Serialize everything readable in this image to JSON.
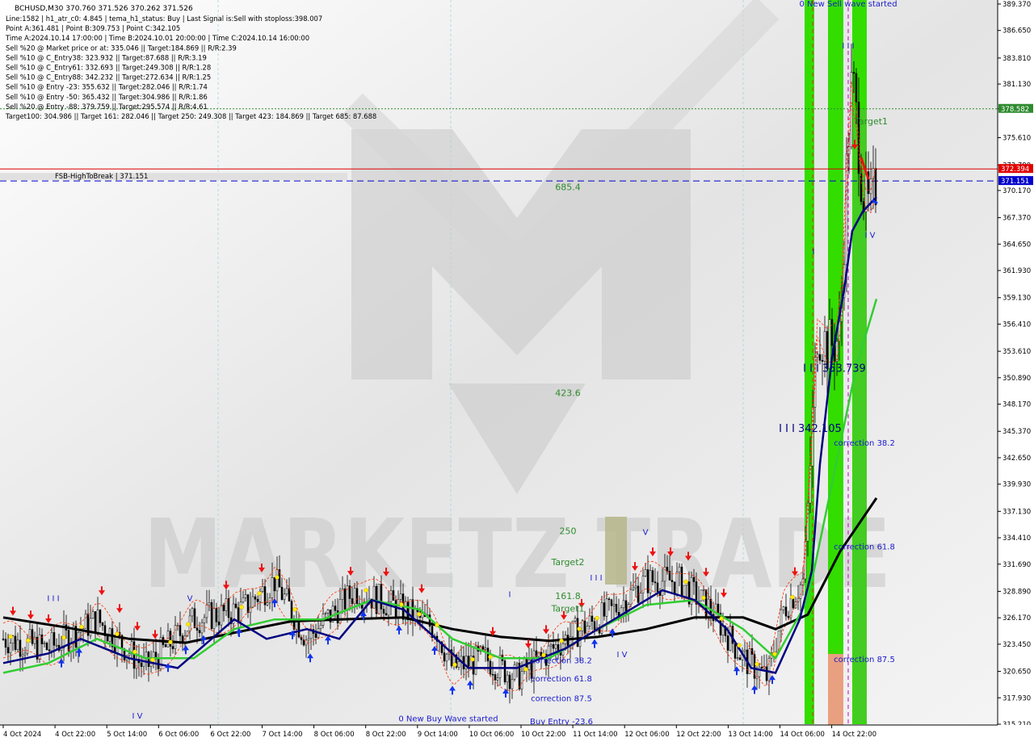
{
  "header": {
    "symbol_line": "BCHUSD,M30  370.760 371.526 370.262 371.526",
    "info_lines": [
      "Line:1582 | h1_atr_c0: 4.845 | tema_h1_status: Buy | Last Signal is:Sell with stoploss:398.007",
      "Point A:361.481 | Point B:309.753 | Point C:342.105",
      "Time A:2024.10.14 17:00:00 | Time B:2024.10.01 20:00:00 | Time C:2024.10.14 16:00:00",
      "Sell %20 @ Market price or at: 335.046 || Target:184.869 || R/R:2.39",
      "Sell %10 @ C_Entry38: 323.932 || Target:87.688 || R/R:3.19",
      "Sell %10 @ C_Entry61: 332.693 || Target:249.308 || R/R:1.28",
      "Sell %10 @ C_Entry88: 342.232 || Target:272.634 || R/R:1.25",
      "Sell %10 @ Entry -23: 355.632 || Target:282.046 || R/R:1.74",
      "Sell %10 @ Entry -50: 365.432 || Target:304.986 || R/R:1.86",
      "Sell %20 @ Entry -88: 379.759 || Target:295.574 || R/R:4.61",
      "Target100: 304.986 || Target 161: 282.046 || Target 250: 249.308 || Target 423: 184.869 || Target 685: 87.688"
    ]
  },
  "watermark": "MARKETZ TRADE",
  "colors": {
    "bull_candle": "#000000",
    "ema_black": "#000000",
    "ema_blue": "#000080",
    "ema_green": "#32cd32",
    "red_line": "#e00000",
    "blue_line": "#0000cc",
    "green_bar": "#33dd00",
    "salmon_bar": "#e8a080",
    "target_green": "#2e8b2e",
    "label_blue": "#1a1acc"
  },
  "chart_data": {
    "type": "candlestick",
    "symbol": "BCHUSD",
    "timeframe": "M30",
    "ylim": [
      315.21,
      389.37
    ],
    "y_ticks": [
      "389.370",
      "386.650",
      "383.810",
      "381.130",
      "378.582",
      "375.610",
      "372.790",
      "370.170",
      "367.370",
      "364.650",
      "361.930",
      "359.130",
      "356.410",
      "353.610",
      "350.890",
      "348.170",
      "345.370",
      "342.650",
      "339.930",
      "337.130",
      "334.410",
      "331.690",
      "328.890",
      "326.170",
      "323.450",
      "320.650",
      "317.930",
      "315.210"
    ],
    "x_labels": [
      "4 Oct 2024",
      "4 Oct 22:00",
      "5 Oct 14:00",
      "6 Oct 06:00",
      "6 Oct 22:00",
      "7 Oct 14:00",
      "8 Oct 06:00",
      "8 Oct 22:00",
      "9 Oct 14:00",
      "10 Oct 06:00",
      "10 Oct 22:00",
      "11 Oct 14:00",
      "12 Oct 06:00",
      "12 Oct 22:00",
      "13 Oct 14:00",
      "14 Oct 06:00",
      "14 Oct 22:00"
    ],
    "price_tags": [
      {
        "value": 378.582,
        "label": "378.582",
        "color": "#2e8b2e"
      },
      {
        "value": 372.394,
        "label": "372.394",
        "color": "#e00000"
      },
      {
        "value": 371.151,
        "label": "371.151",
        "color": "#0000cc"
      }
    ],
    "fsb_label": "FSB-HighToBreak | 371.151",
    "levels": [
      {
        "name": "685.4",
        "y": 370.2
      },
      {
        "name": "423.6",
        "y": 349.0
      },
      {
        "name": "250",
        "y": 334.8
      },
      {
        "name": "Target2",
        "y": 331.6
      },
      {
        "name": "161.8",
        "y": 328.1
      },
      {
        "name": "Target1",
        "y": 326.8
      },
      {
        "name": "Target1",
        "y": 377.0
      }
    ],
    "wave_labels": [
      {
        "text": "0 New Sell wave started",
        "date_x": 1050,
        "y": 389.1
      },
      {
        "text": "0 New Buy Wave started",
        "date_x": 555,
        "y": 315.5
      },
      {
        "text": "I I I  353.739",
        "date_x": 1033,
        "y": 351.5
      },
      {
        "text": "I I I  342.105",
        "date_x": 1003,
        "y": 345.3
      },
      {
        "text": "correction 38.2",
        "date_x": 1070,
        "y": 343.9
      },
      {
        "text": "correction 61.8",
        "date_x": 1070,
        "y": 333.2
      },
      {
        "text": "correction 87.5",
        "date_x": 1070,
        "y": 321.6
      },
      {
        "text": "correction 38.2",
        "date_x": 695,
        "y": 321.5
      },
      {
        "text": "correction 61.8",
        "date_x": 695,
        "y": 319.6
      },
      {
        "text": "correction 87.5",
        "date_x": 695,
        "y": 317.6
      },
      {
        "text": "Buy Entry -23.6",
        "date_x": 695,
        "y": 315.2
      },
      {
        "text": "I I I",
        "date_x": 66,
        "y": 327.9
      },
      {
        "text": "V",
        "date_x": 235,
        "y": 327.9
      },
      {
        "text": "I V",
        "date_x": 170,
        "y": 315.8
      },
      {
        "text": "I",
        "date_x": 631,
        "y": 328.3
      },
      {
        "text": "I V",
        "date_x": 770,
        "y": 322.1
      },
      {
        "text": "V",
        "date_x": 799,
        "y": 334.7
      },
      {
        "text": "I I I",
        "date_x": 738,
        "y": 330.0
      },
      {
        "text": "I V",
        "date_x": 1077,
        "y": 365.3
      },
      {
        "text": "I I I",
        "date_x": 1050,
        "y": 384.8
      },
      {
        "text": "I",
        "date_x": 1007,
        "y": 363.6
      }
    ],
    "series": [
      {
        "name": "EMA black",
        "key": "ema_black"
      },
      {
        "name": "EMA blue",
        "key": "ema_blue"
      },
      {
        "name": "EMA green",
        "key": "ema_green"
      }
    ]
  }
}
